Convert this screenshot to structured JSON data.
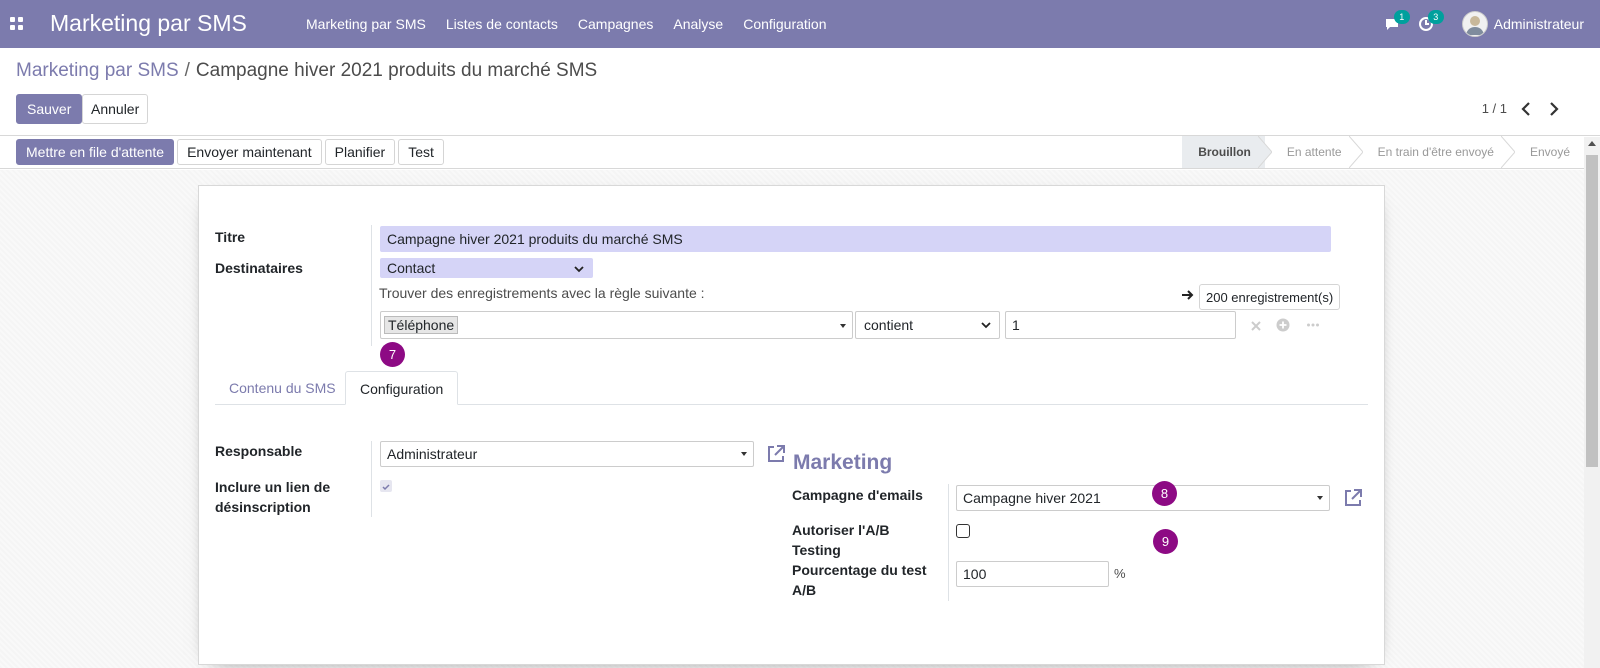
{
  "navbar": {
    "app_title": "Marketing par SMS",
    "menu": [
      "Marketing par SMS",
      "Listes de contacts",
      "Campagnes",
      "Analyse",
      "Configuration"
    ],
    "messages_count": "1",
    "activities_count": "3",
    "user_name": "Administrateur",
    "color": "#7c7bad"
  },
  "breadcrumb": {
    "parent": "Marketing par SMS",
    "separator": "/",
    "current": "Campagne hiver 2021 produits du marché SMS"
  },
  "control": {
    "save_label": "Sauver",
    "cancel_label": "Annuler",
    "pager": "1 / 1"
  },
  "statusbar": {
    "actions": [
      "Mettre en file d'attente",
      "Envoyer maintenant",
      "Planifier",
      "Test"
    ],
    "stages": [
      "Brouillon",
      "En attente",
      "En train d'être envoyé",
      "Envoyé"
    ],
    "active_stage": "Brouillon"
  },
  "form": {
    "title_label": "Titre",
    "title_value": "Campagne hiver 2021 produits du marché SMS",
    "recipients_label": "Destinataires",
    "recipients_value": "Contact",
    "domain_hint": "Trouver des enregistrements avec la règle suivante :",
    "records_count": "200 enregistrement(s)",
    "rule_field": "Téléphone",
    "rule_operator": "contient",
    "rule_value": "1",
    "step_badges": [
      "7",
      "8",
      "9"
    ],
    "tabs": [
      "Contenu du SMS",
      "Configuration"
    ],
    "active_tab": "Configuration",
    "responsible_label": "Responsable",
    "responsible_value": "Administrateur",
    "unsubscribe_label_1": "Inclure un lien de",
    "unsubscribe_label_2": "désinscription",
    "unsubscribe_checked": true,
    "marketing_title": "Marketing",
    "email_campaign_label": "Campagne d'emails",
    "email_campaign_value": "Campagne hiver 2021",
    "ab_testing_label_1": "Autoriser l'A/B",
    "ab_testing_label_2": "Testing",
    "ab_testing_checked": false,
    "ab_percent_label_1": "Pourcentage du test",
    "ab_percent_label_2": "A/B",
    "ab_percent_value": "100",
    "percent_sign": "%"
  },
  "colors": {
    "primary": "#7c7bad",
    "title_bg": "#d5d4f7",
    "badge": "#8d0a84",
    "counter_badge": "#00a09d"
  }
}
